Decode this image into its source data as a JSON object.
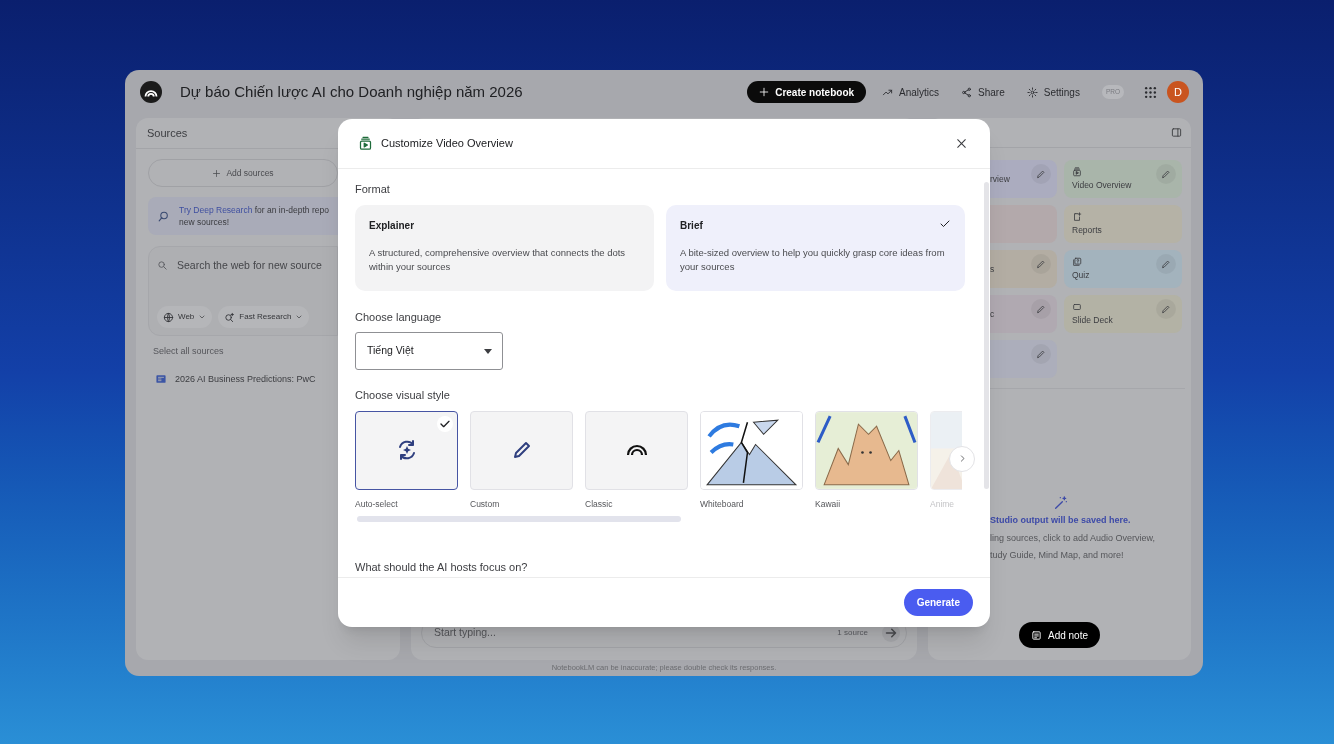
{
  "app_bar": {
    "title": "Dự báo Chiến lược AI cho Doanh nghiệp năm 2026",
    "create_button": "Create notebook",
    "actions": [
      {
        "label": "Analytics"
      },
      {
        "label": "Share"
      },
      {
        "label": "Settings"
      }
    ],
    "badge": "PRO",
    "avatar": "D"
  },
  "sources_panel": {
    "title": "Sources",
    "add_button": "Add sources",
    "tip": {
      "link": "Try Deep Research",
      "line_1": "for an in-depth repo",
      "line_2": "new sources!"
    },
    "search": {
      "placeholder": "Search the web for new source",
      "chips": [
        {
          "label": "Web"
        },
        {
          "label": "Fast Research"
        }
      ]
    },
    "select_all": "Select all sources",
    "sources": [
      {
        "name": "2026 AI Business Predictions: PwC"
      }
    ]
  },
  "chat_panel": {
    "input": {
      "placeholder": "Start typing..."
    },
    "source_count": "1 source"
  },
  "studio_panel": {
    "tiles": [
      {
        "label": "rview",
        "color": "#abacbf",
        "editable": true
      },
      {
        "label": "Video Overview",
        "color": "#a9b5aa",
        "editable": true
      },
      {
        "color": "#b3a9ab",
        "editable": false
      },
      {
        "label": "Reports",
        "color": "#b5b2a6",
        "editable": false
      },
      {
        "label": "s",
        "color": "#b3ada3",
        "editable": true
      },
      {
        "label": "Quiz",
        "color": "#a3b3bd",
        "editable": true
      },
      {
        "label": "c",
        "color": "#b0a9b1",
        "editable": true
      },
      {
        "label": "Slide Deck",
        "color": "#b3b2a5",
        "editable": true
      },
      {
        "color": "#acaebb",
        "editable": true
      }
    ],
    "empty_state": {
      "title": "Studio output will be saved here.",
      "lines": [
        "ling sources, click to add Audio Overview,",
        "tudy Guide, Mind Map, and more!"
      ]
    },
    "add_note": "Add note"
  },
  "disclaimer": "NotebookLM can be inaccurate; please double check its responses.",
  "dialog": {
    "title": "Customize Video Overview",
    "format": {
      "label": "Format",
      "options": [
        {
          "name": "Explainer",
          "description": "A structured, comprehensive overview that connects the dots within your sources",
          "selected": false
        },
        {
          "name": "Brief",
          "description": "A bite-sized overview to help you quickly grasp core ideas from your sources",
          "selected": true
        }
      ]
    },
    "language": {
      "label": "Choose language",
      "value": "Tiếng Việt"
    },
    "visual_style": {
      "label": "Choose visual style",
      "styles": [
        {
          "name": "Auto-select",
          "kind": "icon",
          "selected": true
        },
        {
          "name": "Custom",
          "kind": "icon",
          "selected": false
        },
        {
          "name": "Classic",
          "kind": "icon",
          "selected": false
        },
        {
          "name": "Whiteboard",
          "kind": "picture",
          "selected": false
        },
        {
          "name": "Kawaii",
          "kind": "picture",
          "selected": false
        },
        {
          "name": "Anime",
          "kind": "picture",
          "selected": false
        }
      ]
    },
    "focus_label": "What should the AI hosts focus on?",
    "generate_button": "Generate"
  }
}
